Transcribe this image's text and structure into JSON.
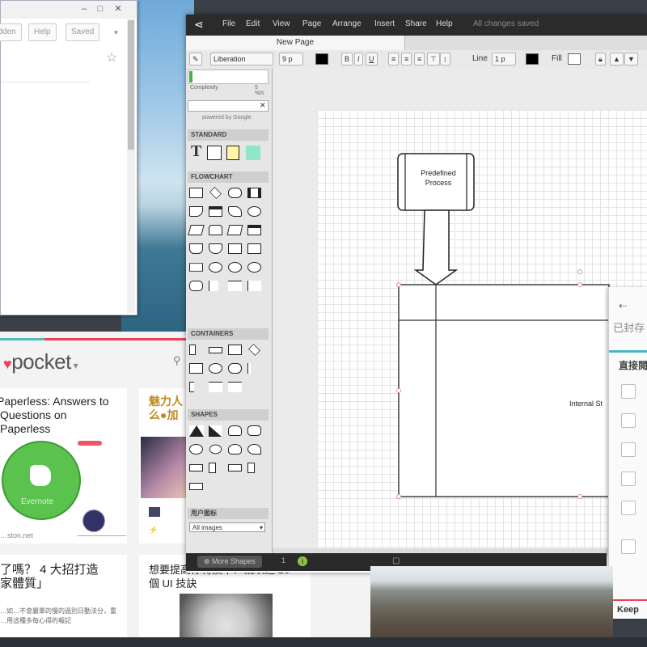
{
  "browser": {
    "buttons": [
      "Hidden",
      "Help",
      "Saved"
    ]
  },
  "pocket": {
    "logo": "pocket",
    "cards": [
      {
        "title": "Paperless: Answers to Questions on Paperless"
      },
      {
        "title": "魅力人 么●加"
      },
      {
        "title": "了嗎？ 4 大招打造 家體質」"
      },
      {
        "title": "想要提高你轉換率？就以這 16 個 UI 技訣"
      }
    ],
    "evernote_label": "Evernote",
    "source": "…ston.net",
    "cjk_snippet": "…如…不會嚴單的慢的過別日動法分，重 …用這種多每心得的報記"
  },
  "drawio": {
    "menu": [
      "File",
      "Edit",
      "View",
      "Page",
      "Arrange",
      "Insert",
      "Share",
      "Help"
    ],
    "status": "All changes saved",
    "tab": "New Page",
    "font_name": "Liberation",
    "font_size": "9 p",
    "line_label": "Line",
    "line_width": "1 p",
    "fill_label": "Fill",
    "sidebar_top": "Complexity",
    "sidebar_percent": "5 %/s",
    "powered_by": "powered by Google",
    "sections": [
      "STANDARD",
      "FLOWCHART",
      "CONTAINERS",
      "SHAPES",
      "用户图标"
    ],
    "images_select": "All images",
    "more_shapes": "More Shapes",
    "canvas": {
      "process_label": "Predefined Process",
      "side_label": "Internal St"
    }
  },
  "rpanel": {
    "title": "已封存",
    "subtitle": "直接閱",
    "footer": "Keep"
  },
  "colors": {
    "pocket_red": "#ef4056",
    "pocket_teal": "#50bcb6",
    "drawio_menubar": "#2b2b2b",
    "evernote_green": "#5bc24e"
  }
}
